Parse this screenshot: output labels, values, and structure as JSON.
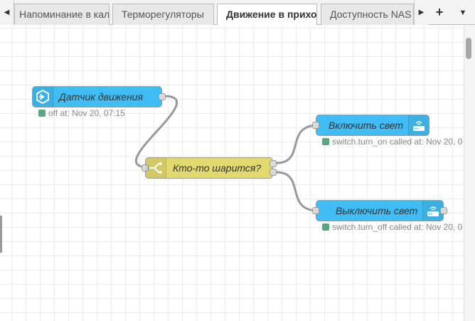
{
  "tabs": [
    {
      "label": "Напоминание в кал"
    },
    {
      "label": "Терморегуляторы"
    },
    {
      "label": "Движение в прихо"
    },
    {
      "label": "Доступность NAS"
    }
  ],
  "active_tab_index": 2,
  "nodes": {
    "motion_sensor": {
      "label": "Датчик движения",
      "status": "off at: Nov 20, 07:15",
      "color": "#41bdf5"
    },
    "switch_node": {
      "label": "Кто-то шарится?",
      "color": "#e2d96e"
    },
    "light_on": {
      "label": "Включить свет",
      "status": "switch.turn_on called at: Nov 20, 0",
      "color": "#41bdf5"
    },
    "light_off": {
      "label": "Выключить свет",
      "status": "switch.turn_off called at: Nov 20, 0",
      "color": "#41bdf5"
    }
  },
  "status_color": "#5aa57f",
  "wire_color": "#999999"
}
